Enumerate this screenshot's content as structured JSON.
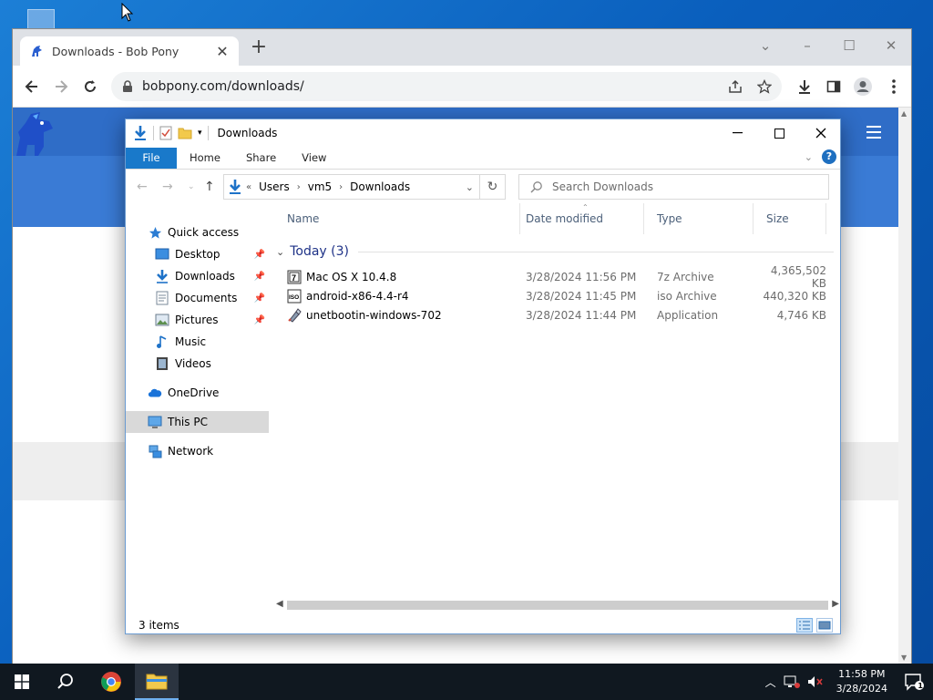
{
  "browser": {
    "tab_title": "Downloads - Bob Pony",
    "url": "bobpony.com/downloads/"
  },
  "explorer": {
    "title": "Downloads",
    "ribbon_tabs": [
      "File",
      "Home",
      "Share",
      "View"
    ],
    "breadcrumb": [
      "Users",
      "vm5",
      "Downloads"
    ],
    "breadcrumb_prefix": "«",
    "search_placeholder": "Search Downloads",
    "nav_items": [
      {
        "label": "Quick access",
        "icon": "star-icon"
      },
      {
        "label": "Desktop",
        "icon": "desktop-icon",
        "pinned": true
      },
      {
        "label": "Downloads",
        "icon": "download-arrow-icon",
        "pinned": true
      },
      {
        "label": "Documents",
        "icon": "documents-icon",
        "pinned": true
      },
      {
        "label": "Pictures",
        "icon": "pictures-icon",
        "pinned": true
      },
      {
        "label": "Music",
        "icon": "music-icon"
      },
      {
        "label": "Videos",
        "icon": "videos-icon"
      },
      {
        "label": "OneDrive",
        "icon": "cloud-icon"
      },
      {
        "label": "This PC",
        "icon": "computer-icon",
        "selected": true
      },
      {
        "label": "Network",
        "icon": "network-icon"
      }
    ],
    "columns": [
      "Name",
      "Date modified",
      "Type",
      "Size"
    ],
    "group_label": "Today (3)",
    "files": [
      {
        "name": "Mac OS X 10.4.8",
        "date": "3/28/2024 11:56 PM",
        "type": "7z Archive",
        "size": "4,365,502 KB",
        "icon": "7z-archive-icon"
      },
      {
        "name": "android-x86-4.4-r4",
        "date": "3/28/2024 11:45 PM",
        "type": "iso Archive",
        "size": "440,320 KB",
        "icon": "iso-archive-icon"
      },
      {
        "name": "unetbootin-windows-702",
        "date": "3/28/2024 11:44 PM",
        "type": "Application",
        "size": "4,746 KB",
        "icon": "application-icon"
      }
    ],
    "status": "3 items"
  },
  "taskbar": {
    "time": "11:58 PM",
    "date": "3/28/2024",
    "notification_count": "1"
  },
  "colors": {
    "desktop": "#0a5fbd",
    "site_header": "#3a7bd5",
    "ribbon_file": "#1979ca",
    "group_header": "#1e3287"
  }
}
